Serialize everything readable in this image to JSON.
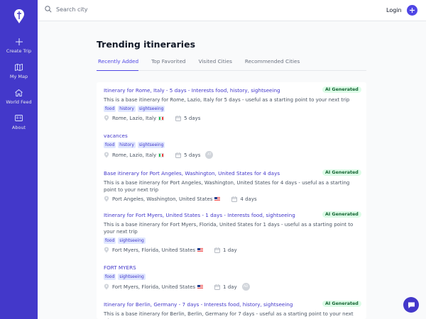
{
  "sidebar": {
    "items": [
      {
        "label": "Create Trip",
        "icon": "plus-icon"
      },
      {
        "label": "My Map",
        "icon": "map-icon"
      },
      {
        "label": "World Feed",
        "icon": "home-icon"
      },
      {
        "label": "About",
        "icon": "id-card-icon"
      }
    ]
  },
  "header": {
    "search_placeholder": "Search city",
    "login_label": "Login",
    "add_label": "+"
  },
  "main": {
    "title": "Trending itineraries",
    "tabs": [
      {
        "label": "Recently Added",
        "active": true
      },
      {
        "label": "Top Favorited",
        "active": false
      },
      {
        "label": "Visited Cities",
        "active": false
      },
      {
        "label": "Recommended Cities",
        "active": false
      }
    ]
  },
  "itineraries": [
    {
      "title": "Itinerary for Rome, Italy - 5 days - Interests food, history, sightseeing",
      "badge": "AI Generated",
      "description": "This is a base itinerary for Rome, Lazio, Italy for 5 days - useful as a starting point to your next trip",
      "tags": [
        "food",
        "history",
        "sightseeing"
      ],
      "location": "Rome, Lazio, Italy",
      "flag": "it",
      "duration": "5 days"
    },
    {
      "title": "vacances",
      "tags": [
        "food",
        "history",
        "sightseeing"
      ],
      "location": "Rome, Lazio, Italy",
      "flag": "it",
      "duration": "5 days",
      "avatar": "AT"
    },
    {
      "title": "Base itinerary for Port Angeles, Washington, United States for 4 days",
      "badge": "AI Generated",
      "description": "This is a base itinerary for Port Angeles, Washington, United States for 4 days - useful as a starting point to your next trip",
      "location": "Port Angeles, Washington, United States",
      "flag": "us",
      "duration": "4 days"
    },
    {
      "title": "Itinerary for Fort Myers, United States - 1 days - Interests food, sightseeing",
      "badge": "AI Generated",
      "description": "This is a base itinerary for Fort Myers, Florida, United States for 1 days - useful as a starting point to your next trip",
      "tags": [
        "food",
        "sightseeing"
      ],
      "location": "Fort Myers, Florida, United States",
      "flag": "us",
      "duration": "1 day"
    },
    {
      "title": "FORT MYERS",
      "tags": [
        "food",
        "sightseeing"
      ],
      "location": "Fort Myers, Florida, United States",
      "flag": "us",
      "duration": "1 day",
      "avatar": "AD"
    },
    {
      "title": "Itinerary for Berlin, Germany - 7 days - Interests food, history, sightseeing",
      "badge": "AI Generated",
      "description": "This is a base itinerary for Berlin, Berlin, Germany for 7 days - useful as a starting point to your next trip"
    }
  ],
  "colors": {
    "sidebar": "#4338ca",
    "accent": "#4f46e5",
    "badge_bg": "#dcfce7",
    "badge_text": "#166534"
  }
}
